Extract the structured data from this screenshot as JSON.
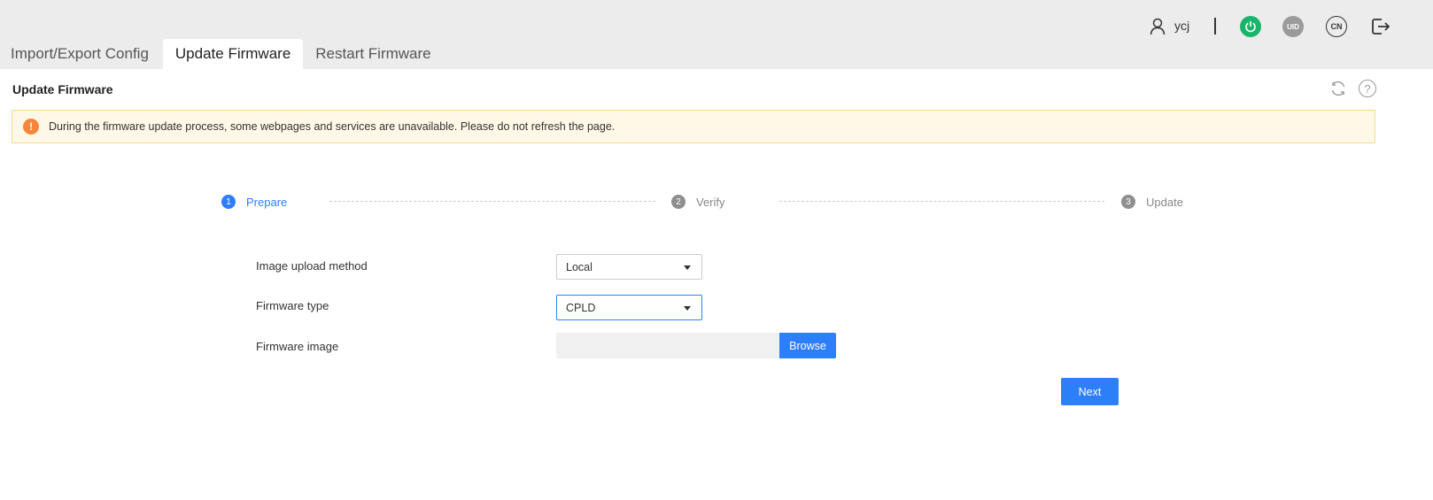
{
  "header": {
    "username": "ycj",
    "uid_badge": "UID",
    "lang_badge": "CN",
    "icons": [
      "user-icon",
      "power-icon",
      "uid-icon",
      "language-icon",
      "logout-icon"
    ],
    "power_color": "#1ab56b"
  },
  "tabs": [
    {
      "label": "Import/Export Config",
      "active": false
    },
    {
      "label": "Update Firmware",
      "active": true
    },
    {
      "label": "Restart Firmware",
      "active": false
    }
  ],
  "panel": {
    "title": "Update Firmware",
    "help_glyph": "?"
  },
  "alert": {
    "icon_glyph": "!",
    "text": "During the firmware update process, some webpages and services are unavailable. Please do not refresh the page."
  },
  "steps": [
    {
      "number": "1",
      "label": "Prepare",
      "state": "active"
    },
    {
      "number": "2",
      "label": "Verify",
      "state": "inactive"
    },
    {
      "number": "3",
      "label": "Update",
      "state": "inactive"
    }
  ],
  "form": {
    "upload_method_label": "Image upload method",
    "upload_method_value": "Local",
    "firmware_type_label": "Firmware type",
    "firmware_type_value": "CPLD",
    "firmware_image_label": "Firmware image",
    "firmware_image_value": "",
    "browse_label": "Browse",
    "next_label": "Next"
  },
  "colors": {
    "accent": "#2d7ff9",
    "warning": "#f5853b",
    "alert_bg": "#fff8e6"
  }
}
